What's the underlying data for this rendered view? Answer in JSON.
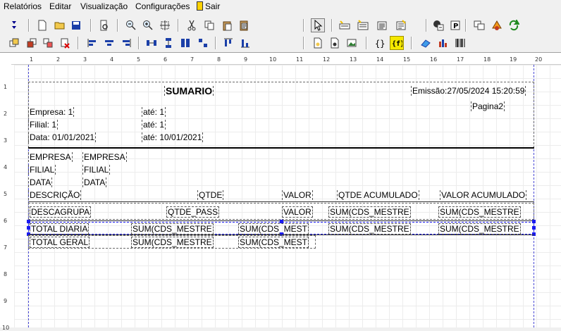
{
  "menu": {
    "relatorios": "Relatórios",
    "editar": "Editar",
    "visualizacao": "Visualização",
    "configuracoes": "Configurações",
    "sair": "Sair"
  },
  "ruler": {
    "top": [
      "1",
      "2",
      "3",
      "4",
      "5",
      "6",
      "7",
      "8",
      "9",
      "10",
      "11",
      "12",
      "13",
      "14",
      "15",
      "16",
      "17",
      "18",
      "19",
      "20"
    ],
    "left": [
      "1",
      "2",
      "3",
      "4",
      "5",
      "6",
      "7",
      "8",
      "9",
      "10"
    ]
  },
  "report": {
    "title": "SUMARIO",
    "emissao": "Emissão:27/05/2024 15:20:59",
    "pagina": "Pagina2",
    "empresa": "Empresa: 1",
    "ate_empresa": "até: 1",
    "filial": "Filial: 1",
    "ate_filial": "até: 1",
    "data": "Data: 01/01/2021",
    "ate_data": "até: 10/01/2021",
    "lbl_empresa": "EMPRESA",
    "val_empresa": "EMPRESA",
    "lbl_filial": "FILIAL",
    "val_filial": "FILIAL",
    "lbl_data": "DATA",
    "val_data": "DATA",
    "col_descricao": "DESCRIÇÃO",
    "col_qtde": "QTDE",
    "col_valor": "VALOR",
    "col_qtde_acum": "QTDE ACUMULADO",
    "col_valor_acum": "VALOR ACUMULADO",
    "row_descagrupa": "DESCAGRUPA",
    "row_qtde_pass": "QTDE_PASS",
    "row_valor": "VALOR",
    "row_sum1": "SUM(CDS_MESTRE",
    "row_sum2": "SUM(CDS_MESTRE",
    "total_diaria": "TOTAL DIARIA",
    "td_sum1": "SUM(CDS_MESTRE",
    "td_sum2": "SUM(CDS_MEST",
    "td_sum3": "SUM(CDS_MESTRE",
    "td_sum4": "SUM(CDS_MESTRE",
    "total_geral": "TOTAL GERAL",
    "tg_sum1": "SUM(CDS_MESTRE",
    "tg_sum2": "SUM(CDS_MEST"
  },
  "colors": {
    "grid": "#ececec",
    "margin": "#4b4bd6",
    "handle": "#1a1af0",
    "highlight": "#f5e800"
  }
}
